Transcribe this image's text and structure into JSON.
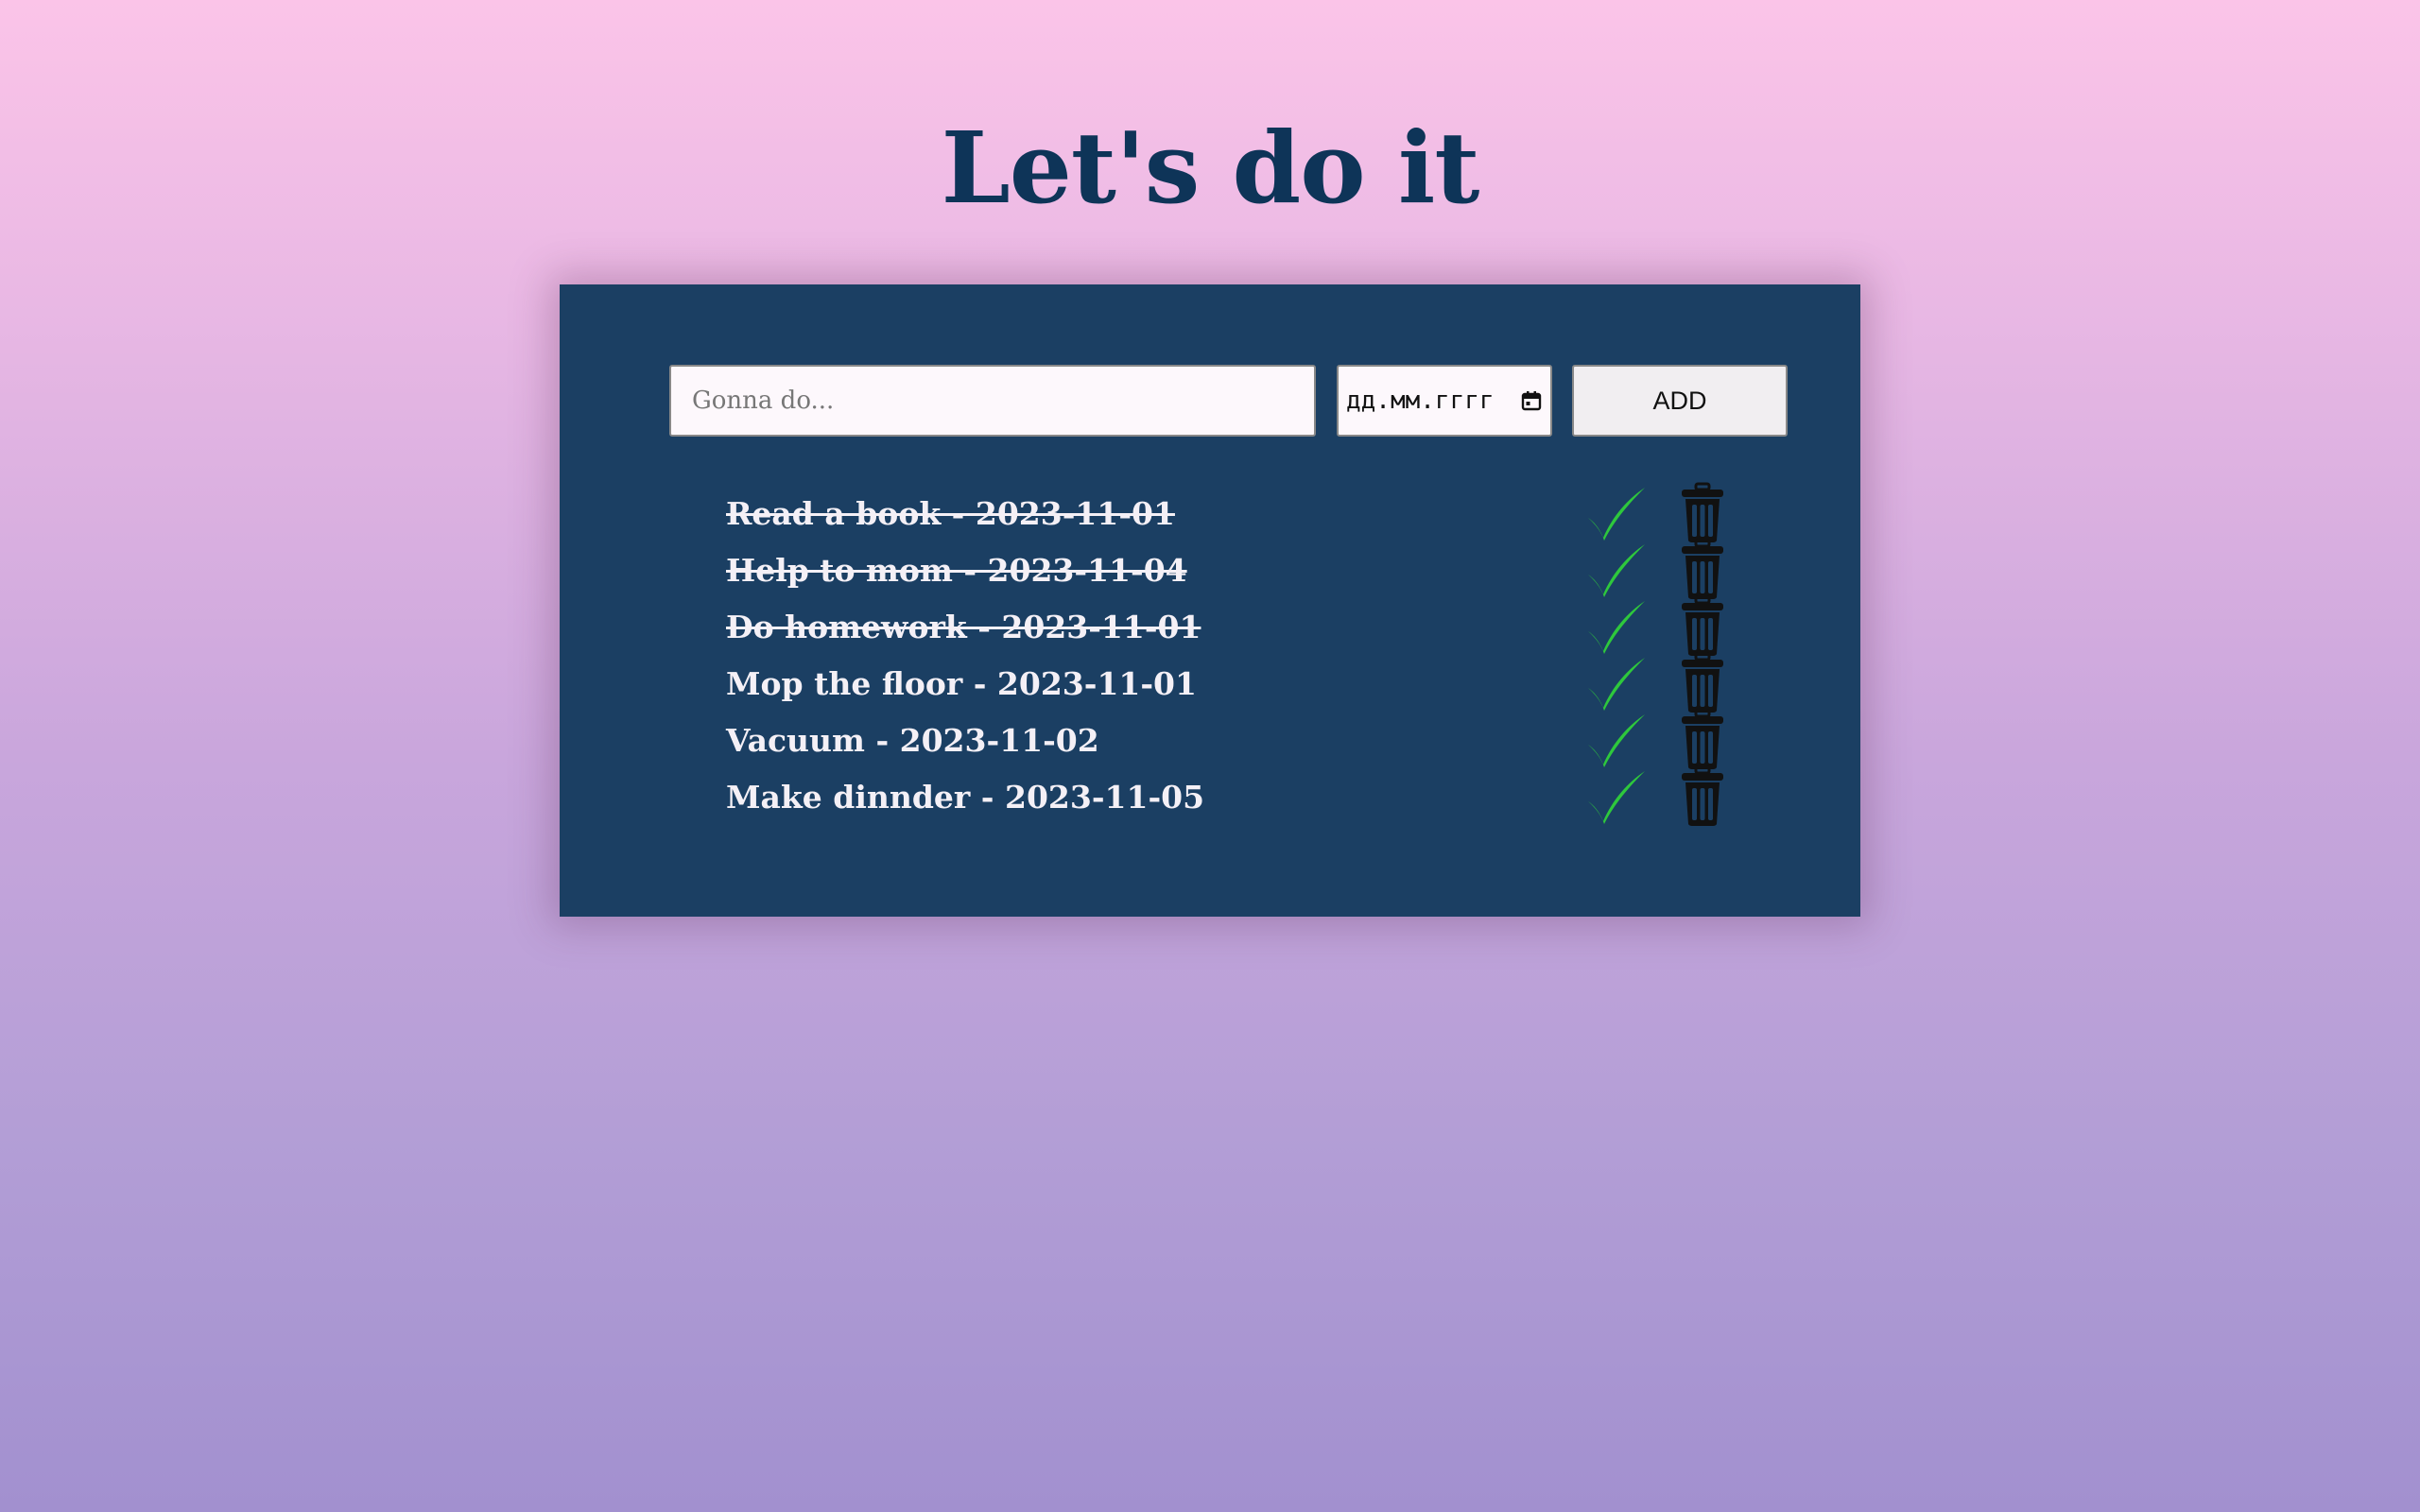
{
  "page": {
    "title": "Let's do it"
  },
  "form": {
    "task_placeholder": "Gonna do...",
    "date_placeholder": "дд.мм.гггг",
    "add_label": "ADD"
  },
  "tasks": [
    {
      "text": "Read a book - 2023-11-01",
      "completed": true
    },
    {
      "text": "Help to mom - 2023-11-04",
      "completed": true
    },
    {
      "text": "Do homework - 2023-11-01",
      "completed": true
    },
    {
      "text": "Mop the floor - 2023-11-01",
      "completed": false
    },
    {
      "text": "Vacuum - 2023-11-02",
      "completed": false
    },
    {
      "text": "Make dinnder - 2023-11-05",
      "completed": false
    }
  ],
  "icons": {
    "complete": "check-icon",
    "delete": "trash-icon",
    "calendar": "calendar-icon"
  },
  "colors": {
    "card_background": "#1b3f63",
    "title": "#0e3458",
    "check": "#2ec83c",
    "trash": "#111111"
  }
}
